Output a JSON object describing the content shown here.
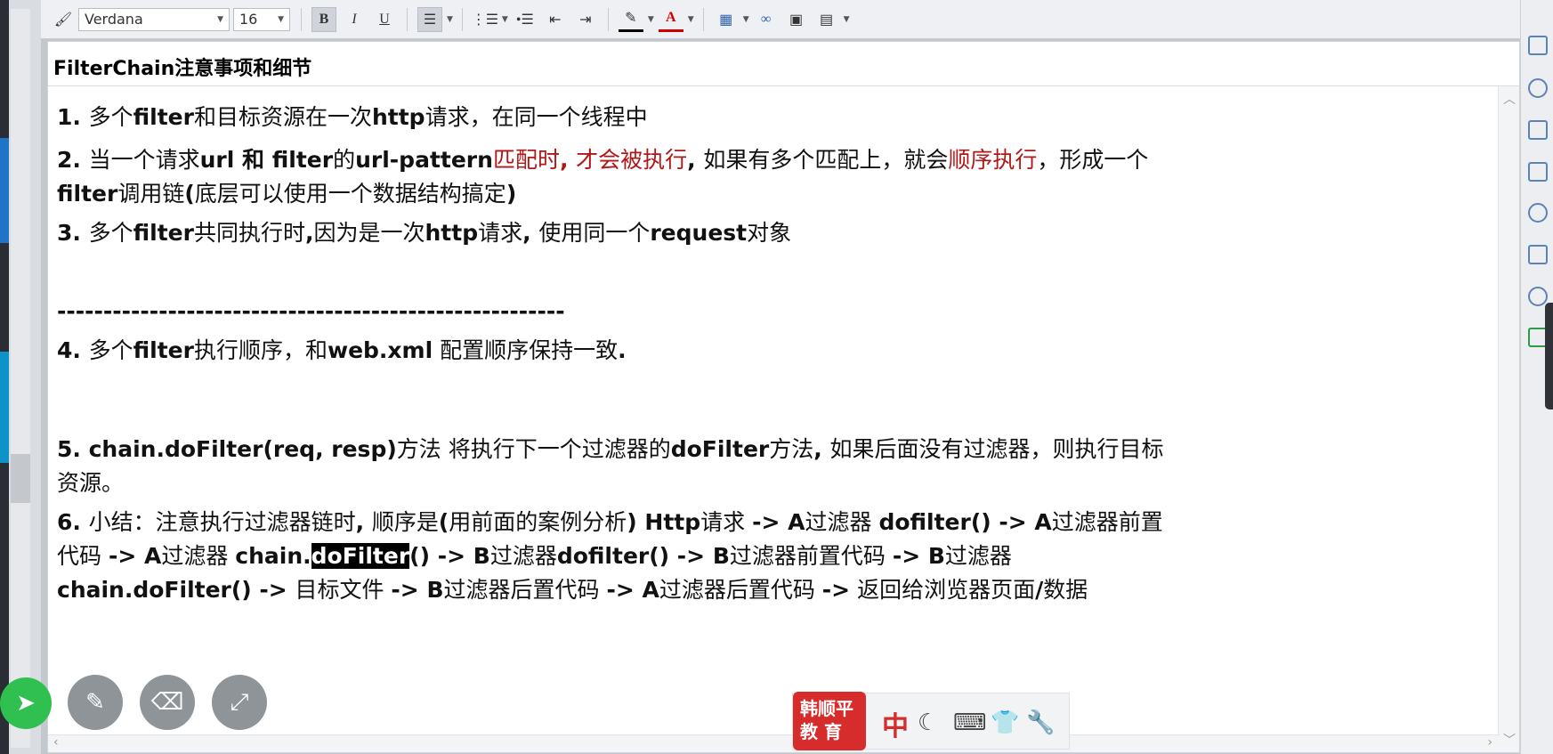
{
  "toolbar": {
    "font_family": "Verdana",
    "font_size": "16",
    "bold": "B",
    "italic": "I",
    "underline": "U",
    "font_color_label": "A"
  },
  "note": {
    "title": "FilterChain注意事项和细节",
    "items": [
      {
        "runs": [
          {
            "t": "1. ",
            "b": true
          },
          {
            "t": "多个"
          },
          {
            "t": "filter",
            "b": true
          },
          {
            "t": "和目标资源在一次"
          },
          {
            "t": "http",
            "b": true
          },
          {
            "t": "请求，在同一个线程中"
          }
        ]
      },
      {
        "runs": [
          {
            "t": "2. ",
            "b": true
          },
          {
            "t": "当一个请求"
          },
          {
            "t": "url",
            "b": true
          },
          {
            "t": " 和 ",
            "b": true
          },
          {
            "t": "filter",
            "b": true
          },
          {
            "t": "的"
          },
          {
            "t": "url-pattern",
            "b": true
          },
          {
            "t": "匹配时",
            "red": true
          },
          {
            "t": ", ",
            "b": true,
            "red": true
          },
          {
            "t": "才会被执行",
            "red": true
          },
          {
            "t": ", ",
            "b": true
          },
          {
            "t": "如果有多个匹配上，就会"
          },
          {
            "t": "顺序执行",
            "red": true
          },
          {
            "t": "，形成一个"
          }
        ]
      },
      {
        "runs": [
          {
            "t": "filter",
            "b": true
          },
          {
            "t": "调用链"
          },
          {
            "t": "(",
            "b": true
          },
          {
            "t": "底层可以使用一个数据结构搞定"
          },
          {
            "t": ")",
            "b": true
          }
        ]
      },
      {
        "runs": [
          {
            "t": "3. ",
            "b": true
          },
          {
            "t": "多个"
          },
          {
            "t": "filter",
            "b": true
          },
          {
            "t": "共同执行时"
          },
          {
            "t": ",",
            "b": true
          },
          {
            "t": "因为是一次"
          },
          {
            "t": "http",
            "b": true
          },
          {
            "t": "请求"
          },
          {
            "t": ", ",
            "b": true
          },
          {
            "t": "使用同一个"
          },
          {
            "t": "request",
            "b": true
          },
          {
            "t": "对象"
          }
        ]
      },
      {
        "runs": [
          {
            "t": "-------------------------------------------------------",
            "b": true
          }
        ]
      },
      {
        "runs": [
          {
            "t": "4. ",
            "b": true
          },
          {
            "t": "多个"
          },
          {
            "t": "filter",
            "b": true
          },
          {
            "t": "执行顺序，和"
          },
          {
            "t": "web.xml",
            "b": true
          },
          {
            "t": " 配置顺序保持一致"
          },
          {
            "t": ".",
            "b": true
          }
        ]
      },
      {
        "runs": [
          {
            "t": "5. chain.doFilter(req, resp)",
            "b": true
          },
          {
            "t": "方法 将执行下一个过滤器的"
          },
          {
            "t": "doFilter",
            "b": true
          },
          {
            "t": "方法"
          },
          {
            "t": ", ",
            "b": true
          },
          {
            "t": "如果后面没有过滤器，则执行目标"
          }
        ]
      },
      {
        "runs": [
          {
            "t": "资源。"
          }
        ]
      },
      {
        "runs": [
          {
            "t": "6. ",
            "b": true
          },
          {
            "t": "小结：注意执行过滤器链时"
          },
          {
            "t": ", ",
            "b": true
          },
          {
            "t": "顺序是"
          },
          {
            "t": "(",
            "b": true
          },
          {
            "t": "用前面的案例分析"
          },
          {
            "t": ") Http",
            "b": true
          },
          {
            "t": "请求 "
          },
          {
            "t": "-> A",
            "b": true
          },
          {
            "t": "过滤器 "
          },
          {
            "t": "dofilter() -> A",
            "b": true
          },
          {
            "t": "过滤器前置"
          }
        ]
      },
      {
        "runs": [
          {
            "t": "代码 "
          },
          {
            "t": "-> A",
            "b": true
          },
          {
            "t": "过滤器 "
          },
          {
            "t": "chain.",
            "b": true
          },
          {
            "t": "doFilter",
            "b": true,
            "hl": true
          },
          {
            "t": "() -> B",
            "b": true
          },
          {
            "t": "过滤器"
          },
          {
            "t": "dofilter() ->  B",
            "b": true
          },
          {
            "t": "过滤器前置代码  "
          },
          {
            "t": "-> B",
            "b": true
          },
          {
            "t": "过滤器"
          }
        ]
      },
      {
        "runs": [
          {
            "t": "chain.doFilter() -> ",
            "b": true
          },
          {
            "t": "目标文件 "
          },
          {
            "t": "-> B",
            "b": true
          },
          {
            "t": "过滤器后置代码 "
          },
          {
            "t": "-> A",
            "b": true
          },
          {
            "t": "过滤器后置代码 "
          },
          {
            "t": "->",
            "b": true
          },
          {
            "t": " 返回给浏览器页面"
          },
          {
            "t": "/",
            "b": true
          },
          {
            "t": "数据"
          }
        ]
      }
    ]
  },
  "ime": {
    "logo_line1": "韩顺平",
    "logo_line2": "教 育",
    "lang": "中"
  },
  "colors": {
    "accent_red": "#b01818",
    "logo_red": "#d62c2c",
    "pointer_green": "#2fc04f"
  }
}
